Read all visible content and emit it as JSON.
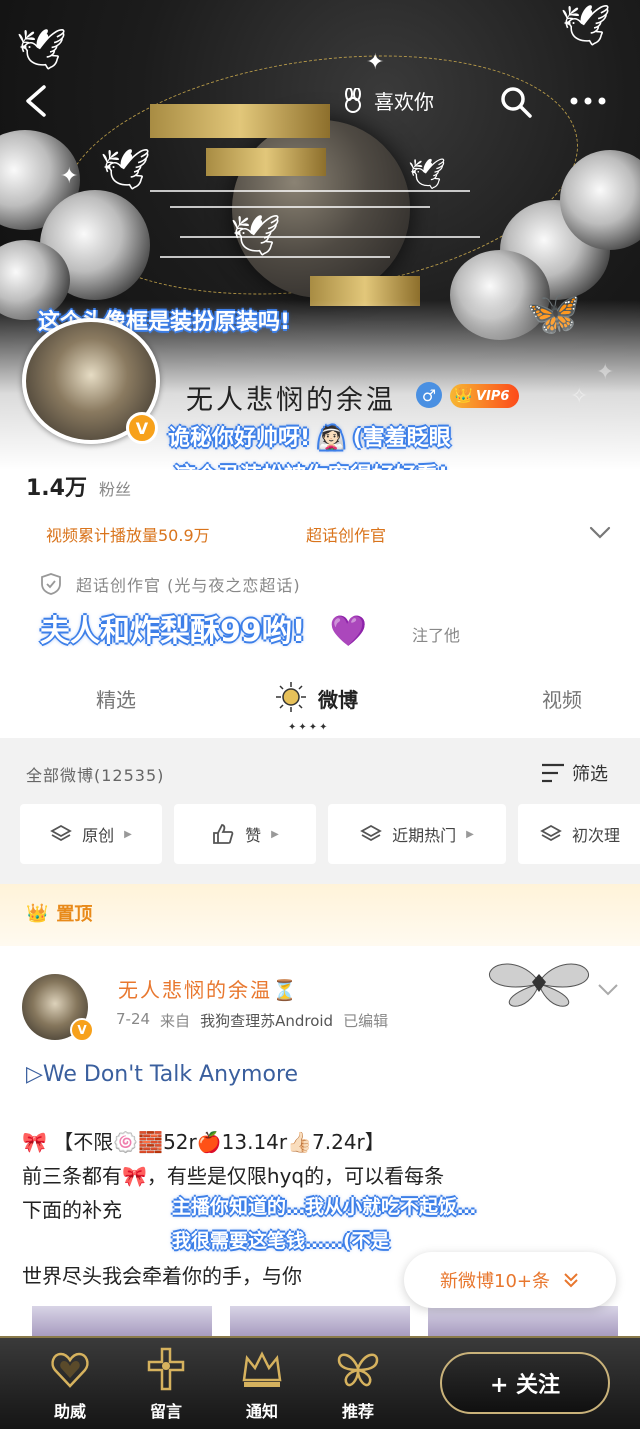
{
  "header": {
    "like_label": "喜欢你",
    "danmaku_1": "这个头像框是装扮原装吗!"
  },
  "profile": {
    "name": "无人悲悯的余温",
    "gender_symbol": "♂",
    "vip_label": "VIP6",
    "verify_symbol": "V",
    "danmaku_2": "诡秘你好帅呀! 👰🏻 (害羞眨眼",
    "danmaku_3": "这个丑装扮被你穿得好好看!",
    "followers_count": "1.4万",
    "followers_label": "粉丝",
    "stat_plays": "视频累计播放量50.9万",
    "stat_role": "超话创作官",
    "chaohua": "超话创作官 (光与夜之恋超话)",
    "danmaku_4": "夫人和炸梨酥99哟!",
    "heart": "💜",
    "follow_text": "注了他"
  },
  "tabs": [
    {
      "label": "精选"
    },
    {
      "label": "微博"
    },
    {
      "label": "视频"
    }
  ],
  "tab_decor": "✦✦✦✦",
  "filter": {
    "all_label": "全部微博(12535)",
    "filter_label": "筛选",
    "chips": [
      {
        "label": "原创"
      },
      {
        "label": "赞"
      },
      {
        "label": "近期热门"
      },
      {
        "label": "初次理"
      }
    ]
  },
  "pinned_label": "置顶",
  "post": {
    "author": "无人悲悯的余温⏳",
    "date": "7-24",
    "from": "来自",
    "source": "我狗查理苏Android",
    "edited": "已编辑",
    "song": "▷We Don't Talk Anymore",
    "line1": "🎀 【不限🍥🧱52r🍎13.14r👍🏻7.24r】",
    "line2": "前三条都有🎀，有些是仅限hyq的，可以看每条",
    "line3_a": "下面的补充",
    "danmaku_5": "主播你知道的…我从小就吃不起饭…",
    "danmaku_6": "我很需要这笔钱……(不是",
    "line4": "世界尽头我会牵着你的手，与你",
    "new_posts": "新微博10+条"
  },
  "bottom_bar": [
    {
      "label": "助威"
    },
    {
      "label": "留言"
    },
    {
      "label": "通知"
    },
    {
      "label": "推荐"
    }
  ],
  "follow_button": "+ 关注",
  "colors": {
    "accent_orange": "#e8772e",
    "danmaku_outline": "#3d7fe8",
    "vip": "#f7a11b",
    "link_blue": "#3a5f9e"
  }
}
